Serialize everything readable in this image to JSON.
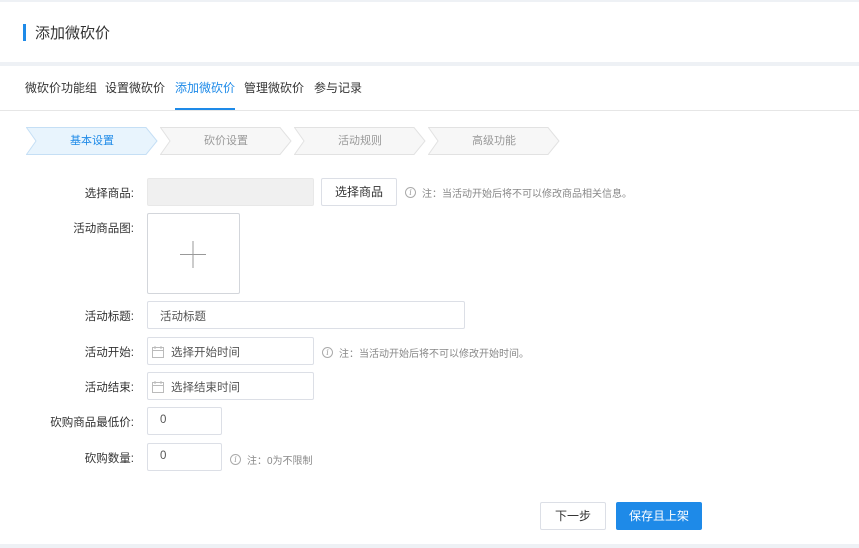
{
  "header": {
    "title": "添加微砍价"
  },
  "tabs": [
    {
      "label": "微砍价功能组"
    },
    {
      "label": "设置微砍价"
    },
    {
      "label": "添加微砍价",
      "active": true
    },
    {
      "label": "管理微砍价"
    },
    {
      "label": "参与记录"
    }
  ],
  "steps": [
    {
      "label": "基本设置",
      "active": true
    },
    {
      "label": "砍价设置"
    },
    {
      "label": "活动规则"
    },
    {
      "label": "高级功能"
    }
  ],
  "form": {
    "product": {
      "label": "选择商品:",
      "value": "",
      "button": "选择商品",
      "hint": "注：当活动开始后将不可以修改商品相关信息。"
    },
    "image": {
      "label": "活动商品图:",
      "upload_glyph": "+"
    },
    "title": {
      "label": "活动标题:",
      "placeholder": "活动标题"
    },
    "start": {
      "label": "活动开始:",
      "placeholder": "选择开始时间",
      "hint": "注：当活动开始后将不可以修改开始时间。"
    },
    "end": {
      "label": "活动结束:",
      "placeholder": "选择结束时间"
    },
    "min_price": {
      "label": "砍购商品最低价:",
      "value": "0"
    },
    "quantity": {
      "label": "砍购数量:",
      "value": "0",
      "hint": "注：0为不限制"
    }
  },
  "actions": {
    "next": "下一步",
    "save": "保存且上架"
  },
  "colors": {
    "accent": "#1e8ae8",
    "step_active_bg": "#e8f4fd"
  }
}
